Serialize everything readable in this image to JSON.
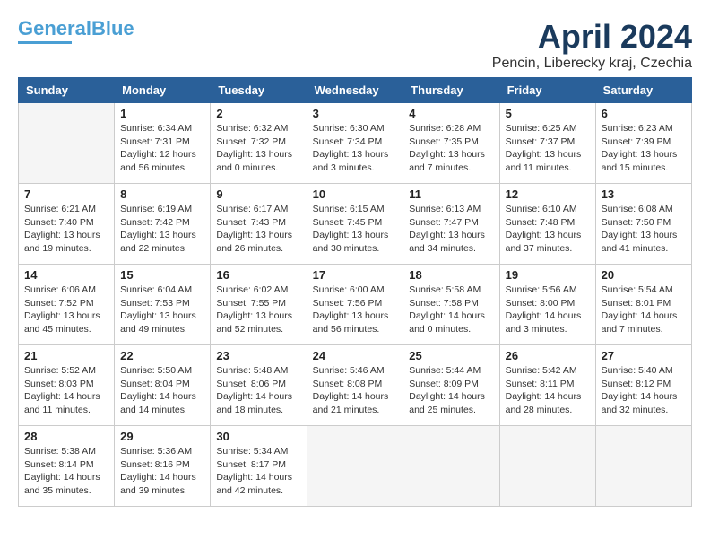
{
  "header": {
    "logo_line1": "General",
    "logo_line2": "Blue",
    "title": "April 2024",
    "subtitle": "Pencin, Liberecky kraj, Czechia"
  },
  "calendar": {
    "days_of_week": [
      "Sunday",
      "Monday",
      "Tuesday",
      "Wednesday",
      "Thursday",
      "Friday",
      "Saturday"
    ],
    "weeks": [
      [
        {
          "day": "",
          "info": ""
        },
        {
          "day": "1",
          "info": "Sunrise: 6:34 AM\nSunset: 7:31 PM\nDaylight: 12 hours\nand 56 minutes."
        },
        {
          "day": "2",
          "info": "Sunrise: 6:32 AM\nSunset: 7:32 PM\nDaylight: 13 hours\nand 0 minutes."
        },
        {
          "day": "3",
          "info": "Sunrise: 6:30 AM\nSunset: 7:34 PM\nDaylight: 13 hours\nand 3 minutes."
        },
        {
          "day": "4",
          "info": "Sunrise: 6:28 AM\nSunset: 7:35 PM\nDaylight: 13 hours\nand 7 minutes."
        },
        {
          "day": "5",
          "info": "Sunrise: 6:25 AM\nSunset: 7:37 PM\nDaylight: 13 hours\nand 11 minutes."
        },
        {
          "day": "6",
          "info": "Sunrise: 6:23 AM\nSunset: 7:39 PM\nDaylight: 13 hours\nand 15 minutes."
        }
      ],
      [
        {
          "day": "7",
          "info": "Sunrise: 6:21 AM\nSunset: 7:40 PM\nDaylight: 13 hours\nand 19 minutes."
        },
        {
          "day": "8",
          "info": "Sunrise: 6:19 AM\nSunset: 7:42 PM\nDaylight: 13 hours\nand 22 minutes."
        },
        {
          "day": "9",
          "info": "Sunrise: 6:17 AM\nSunset: 7:43 PM\nDaylight: 13 hours\nand 26 minutes."
        },
        {
          "day": "10",
          "info": "Sunrise: 6:15 AM\nSunset: 7:45 PM\nDaylight: 13 hours\nand 30 minutes."
        },
        {
          "day": "11",
          "info": "Sunrise: 6:13 AM\nSunset: 7:47 PM\nDaylight: 13 hours\nand 34 minutes."
        },
        {
          "day": "12",
          "info": "Sunrise: 6:10 AM\nSunset: 7:48 PM\nDaylight: 13 hours\nand 37 minutes."
        },
        {
          "day": "13",
          "info": "Sunrise: 6:08 AM\nSunset: 7:50 PM\nDaylight: 13 hours\nand 41 minutes."
        }
      ],
      [
        {
          "day": "14",
          "info": "Sunrise: 6:06 AM\nSunset: 7:52 PM\nDaylight: 13 hours\nand 45 minutes."
        },
        {
          "day": "15",
          "info": "Sunrise: 6:04 AM\nSunset: 7:53 PM\nDaylight: 13 hours\nand 49 minutes."
        },
        {
          "day": "16",
          "info": "Sunrise: 6:02 AM\nSunset: 7:55 PM\nDaylight: 13 hours\nand 52 minutes."
        },
        {
          "day": "17",
          "info": "Sunrise: 6:00 AM\nSunset: 7:56 PM\nDaylight: 13 hours\nand 56 minutes."
        },
        {
          "day": "18",
          "info": "Sunrise: 5:58 AM\nSunset: 7:58 PM\nDaylight: 14 hours\nand 0 minutes."
        },
        {
          "day": "19",
          "info": "Sunrise: 5:56 AM\nSunset: 8:00 PM\nDaylight: 14 hours\nand 3 minutes."
        },
        {
          "day": "20",
          "info": "Sunrise: 5:54 AM\nSunset: 8:01 PM\nDaylight: 14 hours\nand 7 minutes."
        }
      ],
      [
        {
          "day": "21",
          "info": "Sunrise: 5:52 AM\nSunset: 8:03 PM\nDaylight: 14 hours\nand 11 minutes."
        },
        {
          "day": "22",
          "info": "Sunrise: 5:50 AM\nSunset: 8:04 PM\nDaylight: 14 hours\nand 14 minutes."
        },
        {
          "day": "23",
          "info": "Sunrise: 5:48 AM\nSunset: 8:06 PM\nDaylight: 14 hours\nand 18 minutes."
        },
        {
          "day": "24",
          "info": "Sunrise: 5:46 AM\nSunset: 8:08 PM\nDaylight: 14 hours\nand 21 minutes."
        },
        {
          "day": "25",
          "info": "Sunrise: 5:44 AM\nSunset: 8:09 PM\nDaylight: 14 hours\nand 25 minutes."
        },
        {
          "day": "26",
          "info": "Sunrise: 5:42 AM\nSunset: 8:11 PM\nDaylight: 14 hours\nand 28 minutes."
        },
        {
          "day": "27",
          "info": "Sunrise: 5:40 AM\nSunset: 8:12 PM\nDaylight: 14 hours\nand 32 minutes."
        }
      ],
      [
        {
          "day": "28",
          "info": "Sunrise: 5:38 AM\nSunset: 8:14 PM\nDaylight: 14 hours\nand 35 minutes."
        },
        {
          "day": "29",
          "info": "Sunrise: 5:36 AM\nSunset: 8:16 PM\nDaylight: 14 hours\nand 39 minutes."
        },
        {
          "day": "30",
          "info": "Sunrise: 5:34 AM\nSunset: 8:17 PM\nDaylight: 14 hours\nand 42 minutes."
        },
        {
          "day": "",
          "info": ""
        },
        {
          "day": "",
          "info": ""
        },
        {
          "day": "",
          "info": ""
        },
        {
          "day": "",
          "info": ""
        }
      ]
    ]
  }
}
